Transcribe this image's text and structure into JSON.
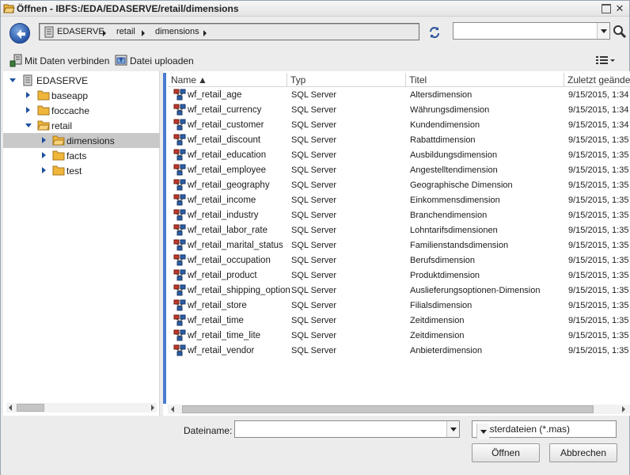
{
  "window": {
    "title": "Öffnen - IBFS:/EDA/EDASERVE/retail/dimensions"
  },
  "breadcrumb": {
    "items": [
      "EDASERVE",
      "retail",
      "dimensions"
    ]
  },
  "search": {
    "value": "",
    "placeholder": ""
  },
  "toolbar": {
    "connect_label": "Mit Daten verbinden",
    "upload_label": "Datei uploaden"
  },
  "tree": {
    "root": "EDASERVE",
    "items": [
      {
        "label": "baseapp",
        "level": 1,
        "expanded": false,
        "selected": false
      },
      {
        "label": "foccache",
        "level": 1,
        "expanded": false,
        "selected": false
      },
      {
        "label": "retail",
        "level": 1,
        "expanded": true,
        "selected": false
      },
      {
        "label": "dimensions",
        "level": 2,
        "expanded": false,
        "selected": true
      },
      {
        "label": "facts",
        "level": 2,
        "expanded": false,
        "selected": false
      },
      {
        "label": "test",
        "level": 2,
        "expanded": false,
        "selected": false
      }
    ]
  },
  "files": {
    "columns": [
      "Name",
      "Typ",
      "Titel",
      "Zuletzt geänder"
    ],
    "rows": [
      {
        "name": "wf_retail_age",
        "type": "SQL Server",
        "title": "Altersdimension",
        "date": "9/15/2015, 1:34"
      },
      {
        "name": "wf_retail_currency",
        "type": "SQL Server",
        "title": "Währungsdimension",
        "date": "9/15/2015, 1:34"
      },
      {
        "name": "wf_retail_customer",
        "type": "SQL Server",
        "title": "Kundendimension",
        "date": "9/15/2015, 1:34"
      },
      {
        "name": "wf_retail_discount",
        "type": "SQL Server",
        "title": "Rabattdimension",
        "date": "9/15/2015, 1:35"
      },
      {
        "name": "wf_retail_education",
        "type": "SQL Server",
        "title": "Ausbildungsdimension",
        "date": "9/15/2015, 1:35"
      },
      {
        "name": "wf_retail_employee",
        "type": "SQL Server",
        "title": "Angestelltendimension",
        "date": "9/15/2015, 1:35"
      },
      {
        "name": "wf_retail_geography",
        "type": "SQL Server",
        "title": "Geographische Dimension",
        "date": "9/15/2015, 1:35"
      },
      {
        "name": "wf_retail_income",
        "type": "SQL Server",
        "title": "Einkommensdimension",
        "date": "9/15/2015, 1:35"
      },
      {
        "name": "wf_retail_industry",
        "type": "SQL Server",
        "title": "Branchendimension",
        "date": "9/15/2015, 1:35"
      },
      {
        "name": "wf_retail_labor_rate",
        "type": "SQL Server",
        "title": "Lohntarifsdimensionen",
        "date": "9/15/2015, 1:35"
      },
      {
        "name": "wf_retail_marital_status",
        "type": "SQL Server",
        "title": "Familienstandsdimension",
        "date": "9/15/2015, 1:35"
      },
      {
        "name": "wf_retail_occupation",
        "type": "SQL Server",
        "title": "Berufsdimension",
        "date": "9/15/2015, 1:35"
      },
      {
        "name": "wf_retail_product",
        "type": "SQL Server",
        "title": "Produktdimension",
        "date": "9/15/2015, 1:35"
      },
      {
        "name": "wf_retail_shipping_option",
        "type": "SQL Server",
        "title": "Auslieferungsoptionen-Dimension",
        "date": "9/15/2015, 1:35"
      },
      {
        "name": "wf_retail_store",
        "type": "SQL Server",
        "title": "Filialsdimension",
        "date": "9/15/2015, 1:35"
      },
      {
        "name": "wf_retail_time",
        "type": "SQL Server",
        "title": "Zeitdimension",
        "date": "9/15/2015, 1:35"
      },
      {
        "name": "wf_retail_time_lite",
        "type": "SQL Server",
        "title": "Zeitdimension",
        "date": "9/15/2015, 1:35"
      },
      {
        "name": "wf_retail_vendor",
        "type": "SQL Server",
        "title": "Anbieterdimension",
        "date": "9/15/2015, 1:35"
      }
    ]
  },
  "footer": {
    "filename_label": "Dateiname:",
    "filename_value": "",
    "filter_value": "Masterdateien (*.mas)",
    "open_label": "Öffnen",
    "cancel_label": "Abbrechen"
  },
  "colors": {
    "accent": "#4a7bd1",
    "folder": "#f0b63c",
    "selection": "#c9c9c9"
  }
}
